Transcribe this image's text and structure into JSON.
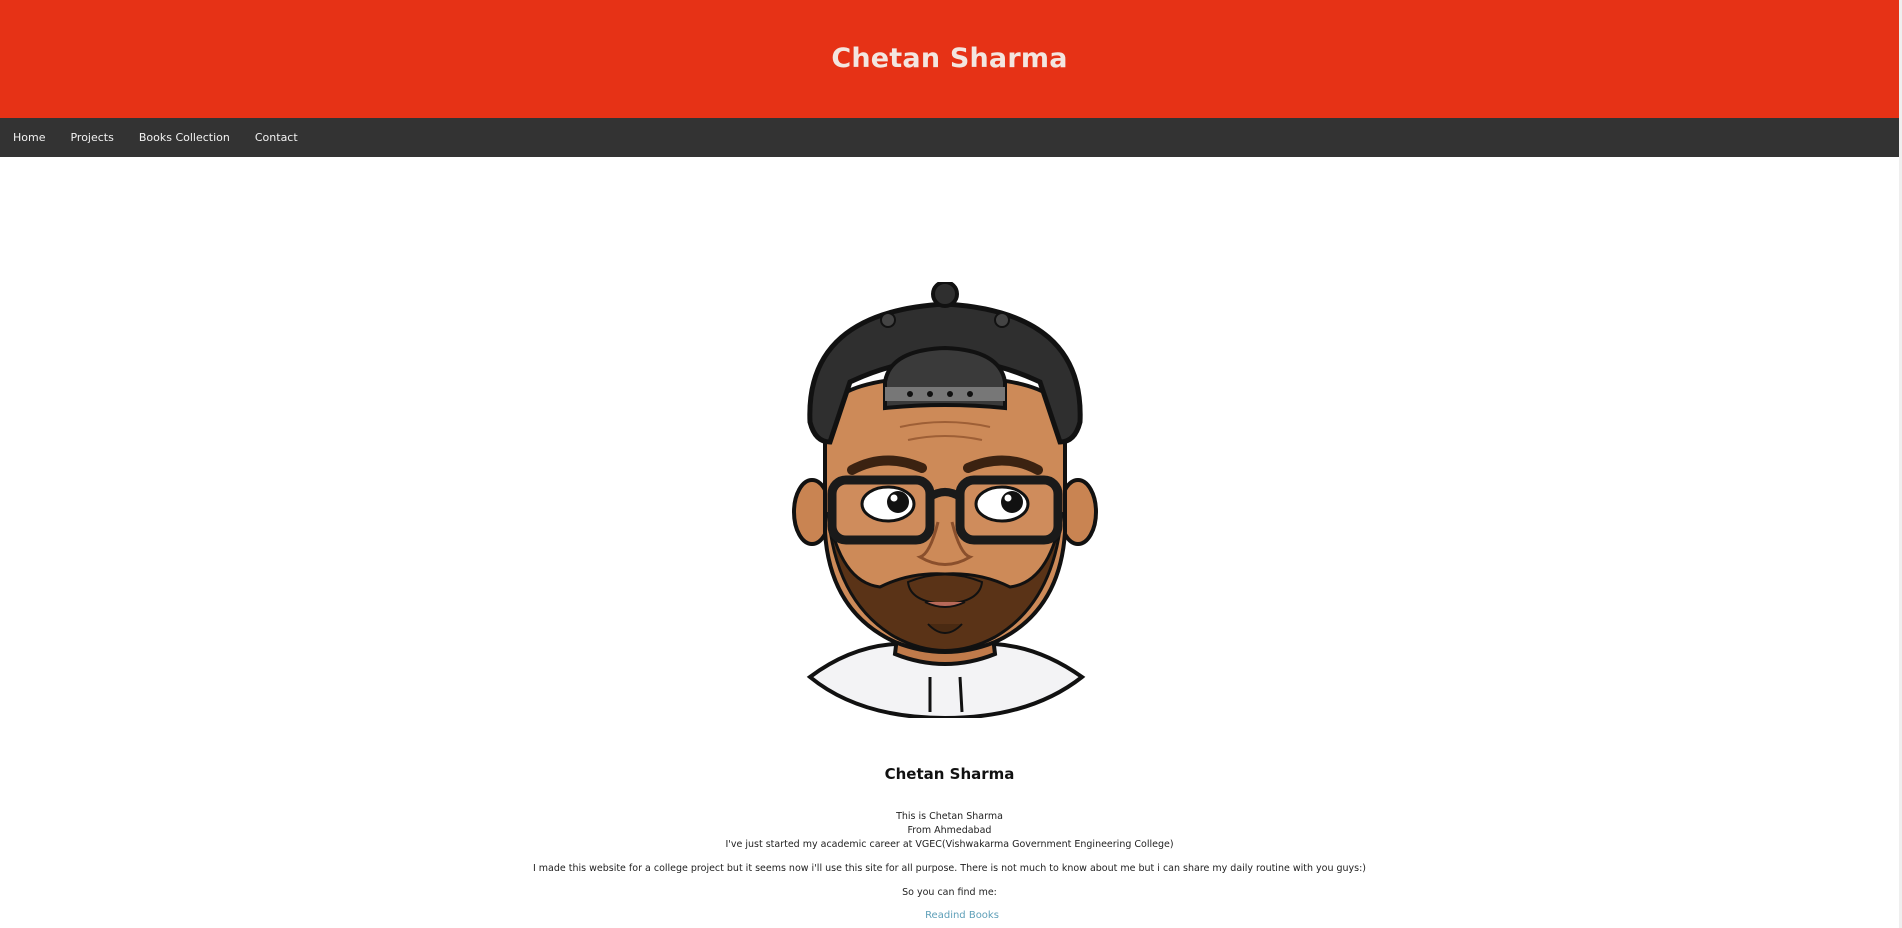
{
  "header": {
    "title": "Chetan Sharma"
  },
  "nav": {
    "items": [
      {
        "label": "Home"
      },
      {
        "label": "Projects"
      },
      {
        "label": "Books Collection"
      },
      {
        "label": "Contact"
      }
    ]
  },
  "avatar": {
    "icon": "bitmoji-avatar-icon"
  },
  "profile": {
    "name": "Chetan Sharma",
    "line1": "This is Chetan Sharma",
    "line2": "From Ahmedabad",
    "line3": "I've just started my academic career at VGEC(Vishwakarma Government Engineering College)",
    "para": "I made this website for a college project but it seems now i'll use this site for all purpose. There is not much to know about me but i can share my daily routine with you guys:)",
    "find": "So you can find me:",
    "link": "Readind Books"
  },
  "colors": {
    "header_bg": "#e63216",
    "nav_bg": "#333333",
    "link": "#5e9fb8"
  }
}
